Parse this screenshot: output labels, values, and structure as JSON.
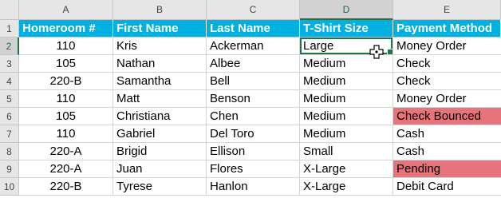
{
  "column_headers": [
    "A",
    "B",
    "C",
    "D",
    "E"
  ],
  "active_column": "D",
  "active_row": "2",
  "header_row": {
    "row_number": "1",
    "cells": [
      "Homeroom #",
      "First Name",
      "Last Name",
      "T-Shirt Size",
      "Payment Method"
    ]
  },
  "rows": [
    {
      "row_number": "2",
      "cells": [
        "110",
        "Kris",
        "Ackerman",
        "Large",
        "Money Order"
      ]
    },
    {
      "row_number": "3",
      "cells": [
        "105",
        "Nathan",
        "Albee",
        "Medium",
        "Check"
      ]
    },
    {
      "row_number": "4",
      "cells": [
        "220-B",
        "Samantha",
        "Bell",
        "Medium",
        "Check"
      ]
    },
    {
      "row_number": "5",
      "cells": [
        "110",
        "Matt",
        "Benson",
        "Medium",
        "Money Order"
      ]
    },
    {
      "row_number": "6",
      "cells": [
        "105",
        "Christiana",
        "Chen",
        "Medium",
        "Check Bounced"
      ]
    },
    {
      "row_number": "7",
      "cells": [
        "110",
        "Gabriel",
        "Del Toro",
        "Medium",
        "Cash"
      ]
    },
    {
      "row_number": "8",
      "cells": [
        "220-A",
        "Brigid",
        "Ellison",
        "Small",
        "Cash"
      ]
    },
    {
      "row_number": "9",
      "cells": [
        "220-A",
        "Juan",
        "Flores",
        "X-Large",
        "Pending"
      ]
    },
    {
      "row_number": "10",
      "cells": [
        "220-B",
        "Tyrese",
        "Hanlon",
        "X-Large",
        "Debit Card"
      ]
    }
  ],
  "colors": {
    "header_fill": "#00b0e0",
    "flag_fill": "#e8737a",
    "selection_border": "#217346"
  },
  "icons": {
    "cursor": "move-cursor-icon"
  }
}
